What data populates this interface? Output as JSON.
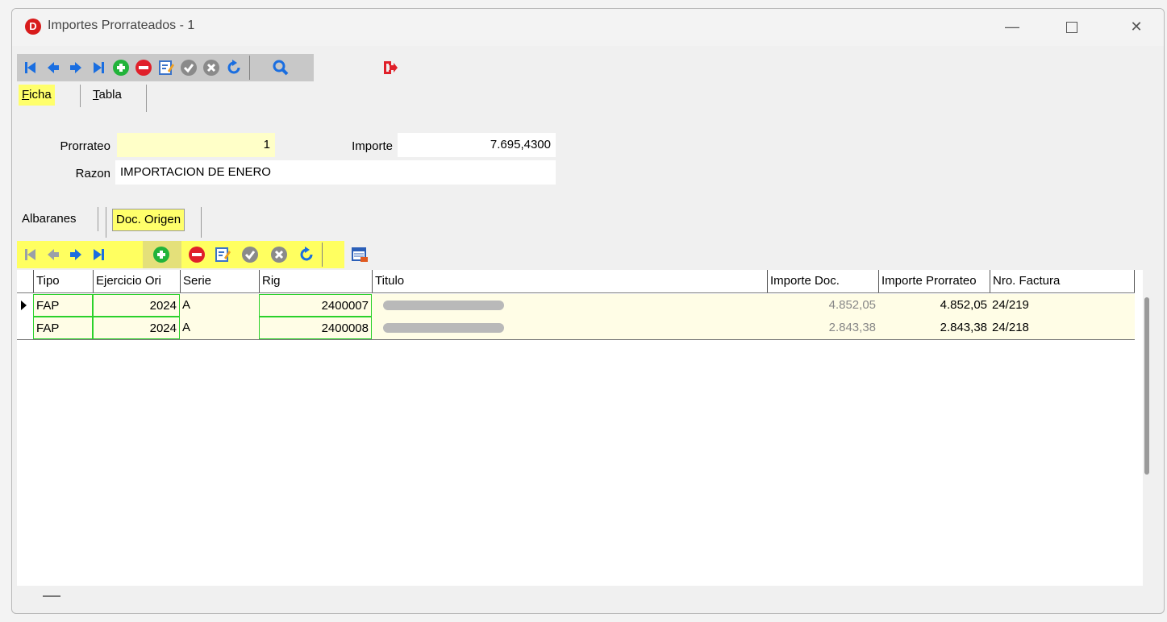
{
  "window": {
    "title": "Importes Prorrateados -   1",
    "logo_letter": "D",
    "controls": {
      "minimize": "—",
      "maximize": "□",
      "close": "✕"
    }
  },
  "toolbar_main": {
    "buttons": [
      "first",
      "prior",
      "next",
      "last",
      "insert",
      "delete",
      "edit",
      "post",
      "cancel",
      "refresh",
      "search",
      "exit"
    ]
  },
  "tabs_top": [
    {
      "label": "Ficha",
      "underline": "F",
      "rest": "icha",
      "active": true
    },
    {
      "label": "Tabla",
      "underline": "T",
      "rest": "abla",
      "active": false
    }
  ],
  "form": {
    "prorrateo_label": "Prorrateo",
    "prorrateo_value": "1",
    "importe_label": "Importe",
    "importe_value": "7.695,4300",
    "razon_label": "Razon",
    "razon_value": "IMPORTACION DE ENERO"
  },
  "tabs_detail": [
    {
      "label": "Albaranes",
      "active": false
    },
    {
      "label": "Doc. Origen",
      "active": true
    }
  ],
  "grid": {
    "columns": [
      "Tipo",
      "Ejercicio Ori",
      "Serie",
      "Rig",
      "Titulo",
      "Importe Doc.",
      "Importe Prorrateo",
      "Nro. Factura"
    ],
    "rows": [
      {
        "tipo": "FAP",
        "ejercicio": "2024",
        "serie": "A",
        "rig": "2400007",
        "titulo": "",
        "importe_doc": "4.852,05",
        "importe_prorrateo": "4.852,05",
        "factura": "24/219",
        "current": true
      },
      {
        "tipo": "FAP",
        "ejercicio": "2024",
        "serie": "A",
        "rig": "2400008",
        "titulo": "",
        "importe_doc": "2.843,38",
        "importe_prorrateo": "2.843,38",
        "factura": "24/218",
        "current": false
      }
    ]
  },
  "colors": {
    "accent_yellow": "#ffff6b",
    "nav_blue": "#1a6ee0",
    "add_green": "#22b33a",
    "delete_red": "#e0202a"
  }
}
